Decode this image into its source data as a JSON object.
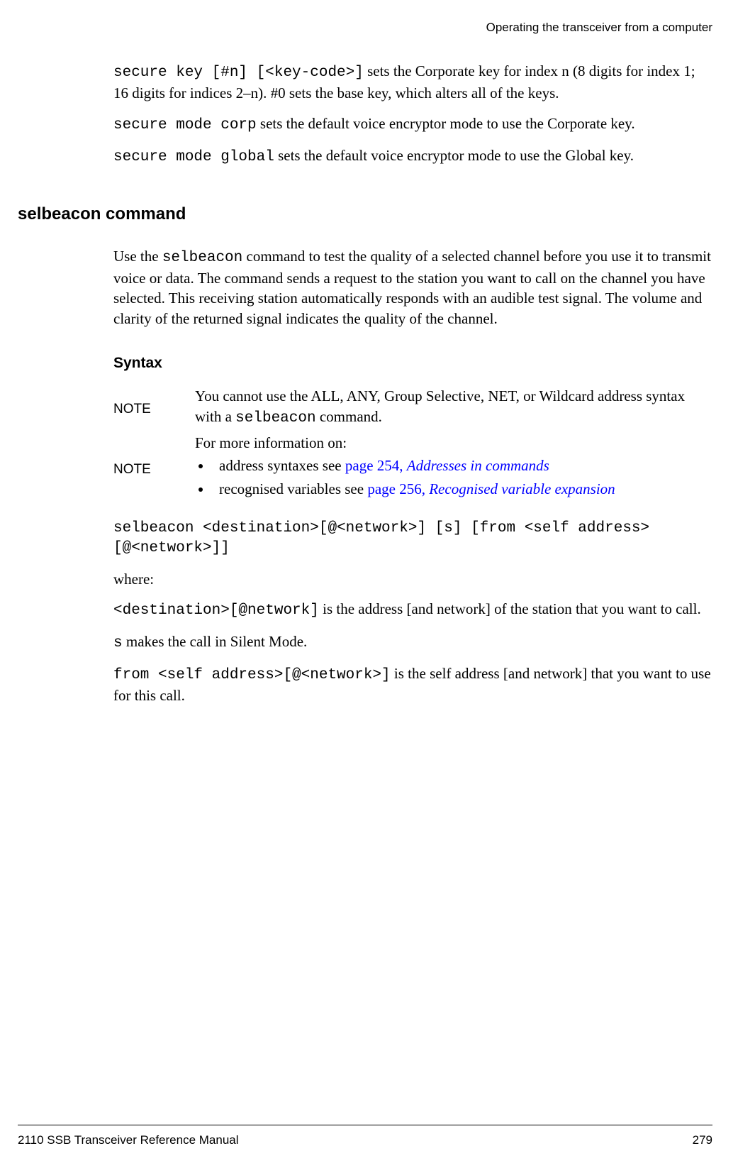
{
  "header": {
    "chapter": "Operating the transceiver from a computer"
  },
  "intro": {
    "p1_cmd": "secure key [#n] [<key-code>]",
    "p1_rest": " sets the Corporate key for index n (8 digits for index 1; 16 digits for indices 2–n). #0 sets the base key, which alters all of the keys.",
    "p2_cmd": "secure mode corp",
    "p2_rest": " sets the default voice encryptor mode to use the Corporate key.",
    "p3_cmd": "secure mode global",
    "p3_rest": " sets the default voice encryptor mode to use the Global key."
  },
  "section": {
    "title": "selbeacon command",
    "body_pre": "Use the ",
    "body_cmd": "selbeacon",
    "body_post": " command to test the quality of a selected channel before you use it to transmit voice or data. The command sends a request to the station you want to call on the channel you have selected. This receiving station automatically responds with an audible test signal. The volume and clarity of the returned signal indicates the quality of the channel."
  },
  "syntax": {
    "heading": "Syntax",
    "note1_label": "NOTE",
    "note1_pre": "You cannot use the ALL, ANY, Group Selective, NET, or Wildcard address syntax with a ",
    "note1_cmd": "selbeacon",
    "note1_post": " command.",
    "note2_label": "NOTE",
    "note2_intro": "For more information on:",
    "note2_b1_text": "address syntaxes see ",
    "note2_b1_page": "page 254, ",
    "note2_b1_link": "Addresses in commands",
    "note2_b2_text": "recognised variables see ",
    "note2_b2_page": "page 256, ",
    "note2_b2_link": "Recognised variable expansion",
    "syntax_line": "selbeacon <destination>[@<network>] [s] [from <self address>[@<network>]]",
    "where": "where:",
    "def1_cmd": "<destination>[@network]",
    "def1_rest": " is the address [and network] of the station that you want to call.",
    "def2_cmd": "s",
    "def2_rest": " makes the call in Silent Mode.",
    "def3_cmd": "from <self address>[@<network>]",
    "def3_rest": " is the self address [and network] that you want to use for this call."
  },
  "footer": {
    "doc": "2110 SSB Transceiver Reference Manual",
    "page": "279"
  }
}
